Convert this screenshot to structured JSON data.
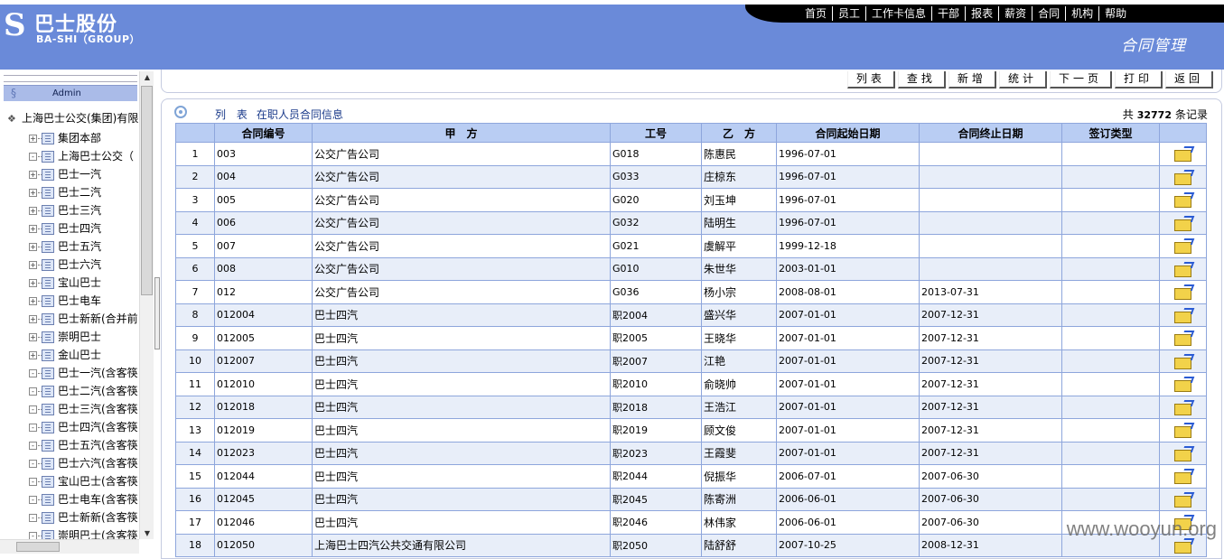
{
  "header": {
    "logo_mark": "S",
    "logo_cn": "巴士股份",
    "logo_en": "BA-SHI（GROUP）",
    "section_title": "合同管理",
    "nav": [
      "首页",
      "员工",
      "工作卡信息",
      "干部",
      "报表",
      "薪资",
      "合同",
      "机构",
      "帮助"
    ]
  },
  "sidebar": {
    "user": "Admin",
    "root": "上海巴士公交(集团)有限",
    "items": [
      {
        "pm": "+",
        "label": "集团本部"
      },
      {
        "pm": "-",
        "label": "上海巴士公交（"
      },
      {
        "pm": "+",
        "label": "巴士一汽"
      },
      {
        "pm": "+",
        "label": "巴士二汽"
      },
      {
        "pm": "+",
        "label": "巴士三汽"
      },
      {
        "pm": "+",
        "label": "巴士四汽"
      },
      {
        "pm": "+",
        "label": "巴士五汽"
      },
      {
        "pm": "+",
        "label": "巴士六汽"
      },
      {
        "pm": "+",
        "label": "宝山巴士"
      },
      {
        "pm": "+",
        "label": "巴士电车"
      },
      {
        "pm": "+",
        "label": "巴士新新(合并前"
      },
      {
        "pm": "+",
        "label": "崇明巴士"
      },
      {
        "pm": "+",
        "label": "金山巴士"
      },
      {
        "pm": "-",
        "label": "巴士一汽(含客筷"
      },
      {
        "pm": "-",
        "label": "巴士二汽(含客筷"
      },
      {
        "pm": "-",
        "label": "巴士三汽(含客筷"
      },
      {
        "pm": "-",
        "label": "巴士四汽(含客筷"
      },
      {
        "pm": "-",
        "label": "巴士五汽(含客筷"
      },
      {
        "pm": "-",
        "label": "巴士六汽(含客筷"
      },
      {
        "pm": "-",
        "label": "宝山巴士(含客筷"
      },
      {
        "pm": "-",
        "label": "巴士电车(含客筷"
      },
      {
        "pm": "-",
        "label": "巴士新新(含客筷"
      },
      {
        "pm": "-",
        "label": "崇明巴士(含客筷"
      }
    ]
  },
  "toolbar": [
    "列表",
    "查找",
    "新增",
    "统计",
    "下一页",
    "打印",
    "返回"
  ],
  "list": {
    "caption_1": "列 表",
    "caption_2": "在职人员合同信息",
    "count_prefix": "共",
    "count": "32772",
    "count_suffix": "条记录"
  },
  "table": {
    "columns": [
      "",
      "合同编号",
      "甲　方",
      "工号",
      "乙　方",
      "合同起始日期",
      "合同终止日期",
      "签订类型",
      ""
    ],
    "rows": [
      [
        "1",
        "003",
        "公交广告公司",
        "G018",
        "陈惠民",
        "1996-07-01",
        "",
        ""
      ],
      [
        "2",
        "004",
        "公交广告公司",
        "G033",
        "庄椋东",
        "1996-07-01",
        "",
        ""
      ],
      [
        "3",
        "005",
        "公交广告公司",
        "G020",
        "刘玉坤",
        "1996-07-01",
        "",
        ""
      ],
      [
        "4",
        "006",
        "公交广告公司",
        "G032",
        "陆明生",
        "1996-07-01",
        "",
        ""
      ],
      [
        "5",
        "007",
        "公交广告公司",
        "G021",
        "虞解平",
        "1999-12-18",
        "",
        ""
      ],
      [
        "6",
        "008",
        "公交广告公司",
        "G010",
        "朱世华",
        "2003-01-01",
        "",
        ""
      ],
      [
        "7",
        "012",
        "公交广告公司",
        "G036",
        "杨小宗",
        "2008-08-01",
        "2013-07-31",
        ""
      ],
      [
        "8",
        "012004",
        "巴士四汽",
        "职2004",
        "盛兴华",
        "2007-01-01",
        "2007-12-31",
        ""
      ],
      [
        "9",
        "012005",
        "巴士四汽",
        "职2005",
        "王晓华",
        "2007-01-01",
        "2007-12-31",
        ""
      ],
      [
        "10",
        "012007",
        "巴士四汽",
        "职2007",
        "江艳",
        "2007-01-01",
        "2007-12-31",
        ""
      ],
      [
        "11",
        "012010",
        "巴士四汽",
        "职2010",
        "俞晓帅",
        "2007-01-01",
        "2007-12-31",
        ""
      ],
      [
        "12",
        "012018",
        "巴士四汽",
        "职2018",
        "王浩江",
        "2007-01-01",
        "2007-12-31",
        ""
      ],
      [
        "13",
        "012019",
        "巴士四汽",
        "职2019",
        "顾文俊",
        "2007-01-01",
        "2007-12-31",
        ""
      ],
      [
        "14",
        "012023",
        "巴士四汽",
        "职2023",
        "王霞斐",
        "2007-01-01",
        "2007-12-31",
        ""
      ],
      [
        "15",
        "012044",
        "巴士四汽",
        "职2044",
        "倪振华",
        "2006-07-01",
        "2007-06-30",
        ""
      ],
      [
        "16",
        "012045",
        "巴士四汽",
        "职2045",
        "陈寄洲",
        "2006-06-01",
        "2007-06-30",
        ""
      ],
      [
        "17",
        "012046",
        "巴士四汽",
        "职2046",
        "林伟家",
        "2006-06-01",
        "2007-06-30",
        ""
      ],
      [
        "18",
        "012050",
        "上海巴士四汽公共交通有限公司",
        "职2050",
        "陆舒舒",
        "2007-10-25",
        "2008-12-31",
        ""
      ]
    ]
  },
  "watermark": "www.wooyun.org",
  "icons": {
    "row_action": "folder-edit-icon",
    "list_marker": "radio-icon"
  },
  "colors": {
    "header_bg": "#6a8ad9",
    "grid_header": "#b9cdf3",
    "grid_border": "#8ea6dc",
    "row_alt": "#e8eef9"
  }
}
